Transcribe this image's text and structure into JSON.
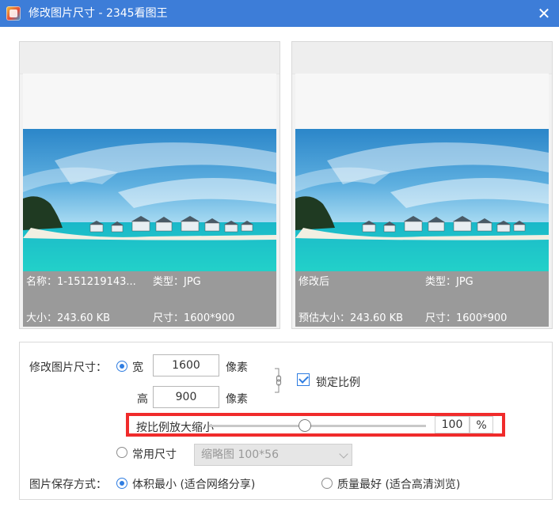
{
  "window": {
    "title": "修改图片尺寸 - 2345看图王",
    "close_glyph": "✕"
  },
  "preview_left": {
    "name_label": "名称：1-151219143...",
    "type_label": "类型：JPG",
    "size_label": "大小：243.60 KB",
    "dim_label": "尺寸：1600*900"
  },
  "preview_right": {
    "name_label": "修改后",
    "type_label": "类型：JPG",
    "size_label": "预估大小：243.60 KB",
    "dim_label": "尺寸：1600*900"
  },
  "resize": {
    "label": "修改图片尺寸：",
    "width_label": "宽",
    "width_value": "1600",
    "height_label": "高",
    "height_value": "900",
    "unit_width": "像素",
    "unit_height": "像素",
    "lock_ratio_label": "锁定比例",
    "lock_ratio_checked": true
  },
  "scale": {
    "label": "按比例放大缩小",
    "value": "100",
    "unit": "%",
    "slider_fraction": 0.44
  },
  "common_size": {
    "label": "常用尺寸",
    "selected": "缩略图 100*56"
  },
  "save_mode": {
    "label": "图片保存方式：",
    "option_small": "体积最小 (适合网络分享)",
    "option_best": "质量最好 (适合高清浏览)"
  },
  "colors": {
    "titlebar": "#3d7dd8",
    "accent": "#2f7de1",
    "highlight": "#f02b2b",
    "info_overlay": "#9a9a9a"
  },
  "icons": {
    "app": "app-logo-icon",
    "close": "close-icon",
    "link": "chain-link-icon",
    "chevron": "chevron-down-icon"
  }
}
